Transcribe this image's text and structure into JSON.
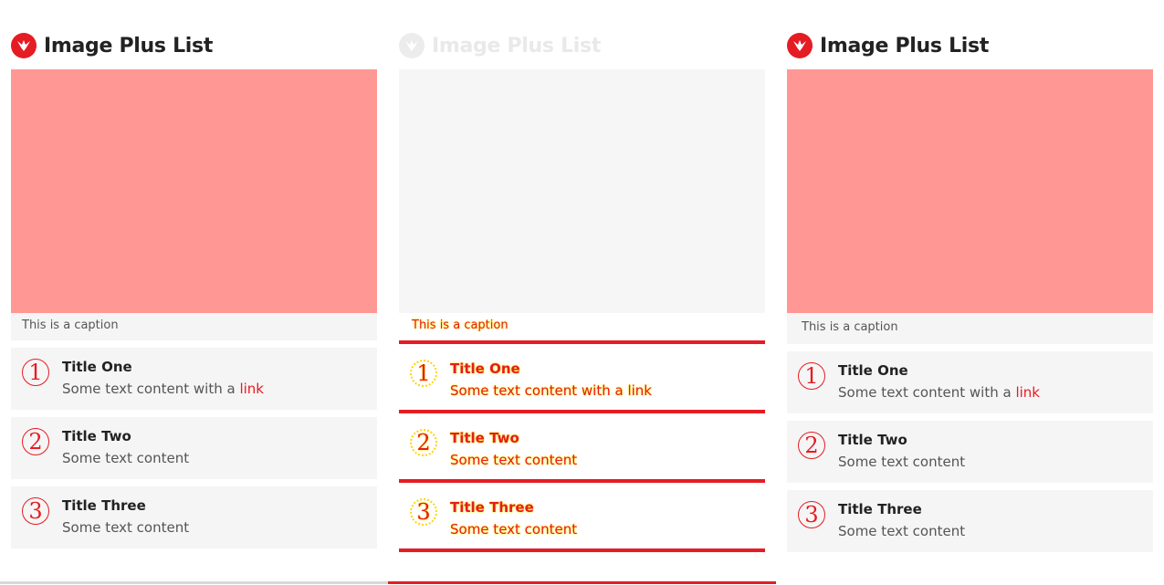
{
  "colors": {
    "accent": "#e51c23",
    "hero": "#ff9895",
    "panel": "#f5f5f5",
    "highlight": "#ffeb00"
  },
  "columns": [
    {
      "title": "Image Plus List",
      "caption": "This is a caption",
      "items": [
        {
          "number": "1",
          "title": "Title One",
          "text": "Some text content with a ",
          "link": "link"
        },
        {
          "number": "2",
          "title": "Title Two",
          "text": "Some text content"
        },
        {
          "number": "3",
          "title": "Title Three",
          "text": "Some text content"
        }
      ]
    },
    {
      "title": "Image Plus List",
      "caption": "This is a caption",
      "items": [
        {
          "number": "1",
          "title": "Title One",
          "text": "Some text content with a ",
          "link": "link"
        },
        {
          "number": "2",
          "title": "Title Two",
          "text": "Some text content"
        },
        {
          "number": "3",
          "title": "Title Three",
          "text": "Some text content"
        }
      ]
    },
    {
      "title": "Image Plus List",
      "caption": "This is a caption",
      "items": [
        {
          "number": "1",
          "title": "Title One",
          "text": "Some text content with a ",
          "link": "link"
        },
        {
          "number": "2",
          "title": "Title Two",
          "text": "Some text content"
        },
        {
          "number": "3",
          "title": "Title Three",
          "text": "Some text content"
        }
      ]
    }
  ]
}
